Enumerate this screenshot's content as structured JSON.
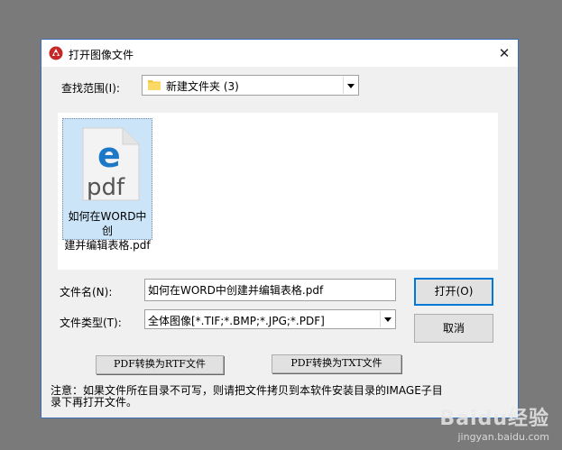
{
  "window": {
    "title": "打开图像文件",
    "close_glyph": "✕"
  },
  "lookin": {
    "label": "查找范围(I):",
    "value": "新建文件夹 (3)"
  },
  "toolbar": {
    "icons": [
      "back-arrow-icon",
      "up-folder-icon",
      "new-folder-icon",
      "view-menu-icon"
    ]
  },
  "files": [
    {
      "name_line1": "如何在WORD中创",
      "name_line2": "建并编辑表格.pdf",
      "icon": "pdf-edge-icon",
      "icon_text": "pdf",
      "icon_letter": "e"
    }
  ],
  "filename": {
    "label": "文件名(N):",
    "value": "如何在WORD中创建并编辑表格.pdf"
  },
  "filetype": {
    "label": "文件类型(T):",
    "value": "全体图像[*.TIF;*.BMP;*.JPG;*.PDF]"
  },
  "buttons": {
    "open": "打开(O)",
    "cancel": "取消",
    "pdf_to_rtf": "PDF转换为RTF文件",
    "pdf_to_txt": "PDF转换为TXT文件"
  },
  "note": "注意：如果文件所在目录不可写，则请把文件拷贝到本软件安装目录的IMAGE子目录下再打开文件。",
  "watermark": {
    "logo": "Baidu经验",
    "url": "jingyan.baidu.com"
  },
  "colors": {
    "accent": "#0078d7",
    "selection": "#cce4f7",
    "edge_blue": "#1e78c8"
  }
}
